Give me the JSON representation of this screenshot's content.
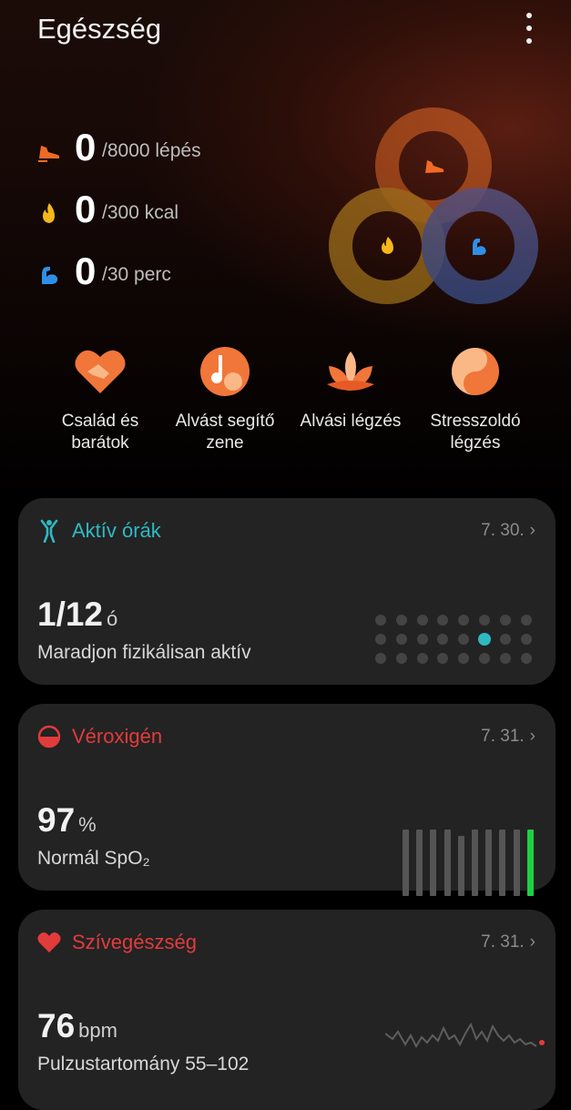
{
  "header": {
    "title": "Egészség"
  },
  "stats": [
    {
      "value": "0",
      "goal": "/8000 lépés",
      "icon": "shoe-icon",
      "color": "#f06a26"
    },
    {
      "value": "0",
      "goal": "/300 kcal",
      "icon": "flame-icon",
      "color": "#f5b81a"
    },
    {
      "value": "0",
      "goal": "/30 perc",
      "icon": "arm-icon",
      "color": "#2f8fe8"
    }
  ],
  "shortcuts": [
    {
      "label": "Család és barátok",
      "icon": "heart-handshake-icon"
    },
    {
      "label": "Alvást segítő zene",
      "icon": "music-note-icon"
    },
    {
      "label": "Alvási légzés",
      "icon": "lotus-icon"
    },
    {
      "label": "Stresszoldó légzés",
      "icon": "yin-yang-icon"
    }
  ],
  "cards": {
    "active": {
      "title": "Aktív órák",
      "date": "7. 30.",
      "value": "1/12",
      "unit": "ó",
      "subtitle": "Maradjon fizikálisan aktív",
      "color": "#2fb9c4",
      "active_hours": 1,
      "goal_hours": 12
    },
    "spo2": {
      "title": "Véroxigén",
      "date": "7. 31.",
      "value": "97",
      "unit": "%",
      "subtitle": "Normál SpO₂",
      "color": "#e23b3b"
    },
    "heart": {
      "title": "Szívegészség",
      "date": "7. 31.",
      "value": "76",
      "unit": "bpm",
      "subtitle": "Pulzustartomány 55–102",
      "color": "#e23b3b"
    }
  }
}
